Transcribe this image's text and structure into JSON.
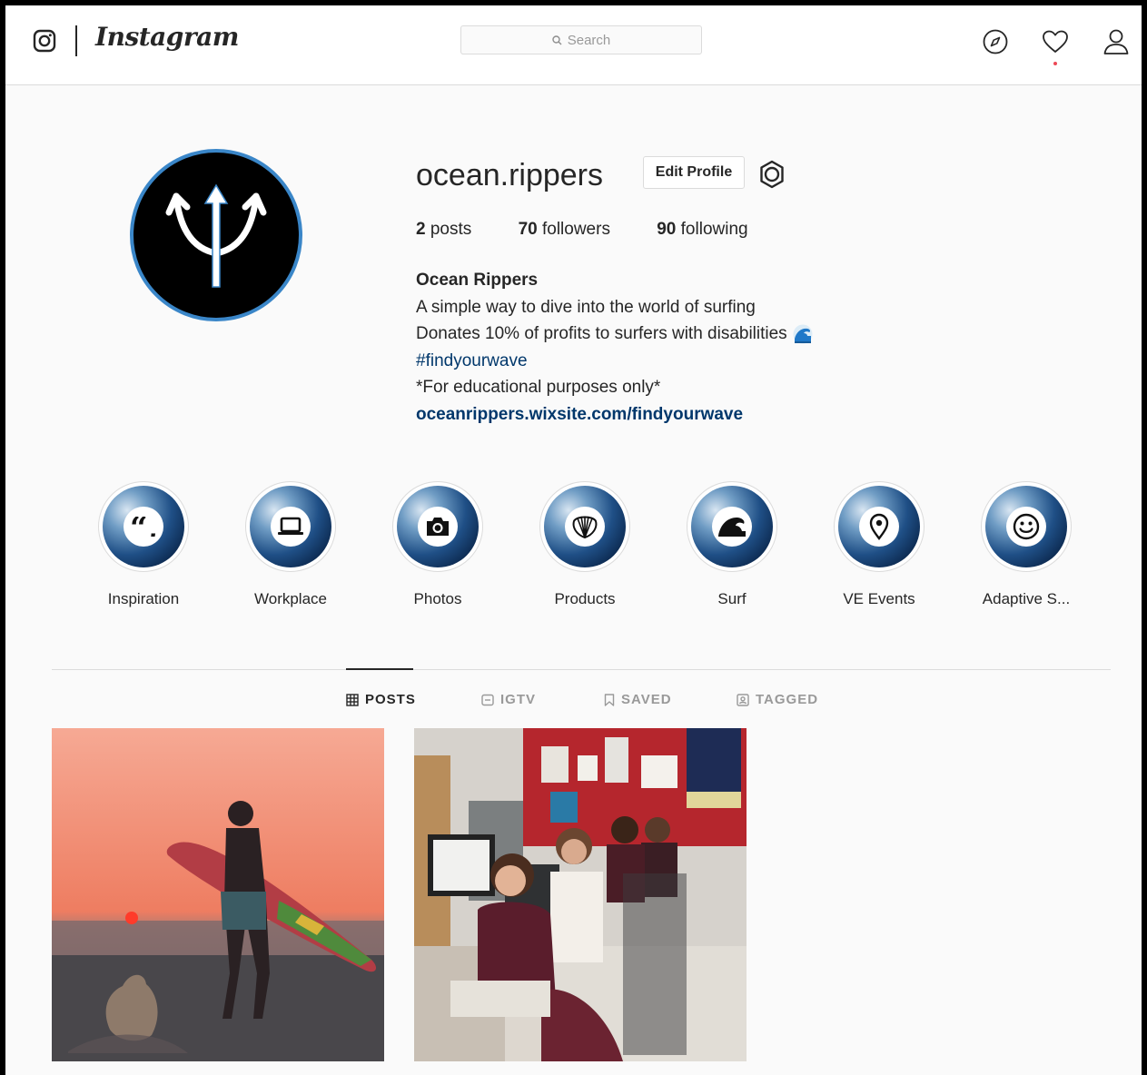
{
  "nav": {
    "logo_text": "Instagram",
    "search_placeholder": "Search",
    "icons": [
      "camera-icon",
      "compass-icon",
      "heart-icon",
      "user-icon"
    ]
  },
  "profile": {
    "username": "ocean.rippers",
    "edit_button": "Edit Profile",
    "stats": {
      "posts_count": "2",
      "posts_label": " posts",
      "followers_count": "70",
      "followers_label": " followers",
      "following_count": "90",
      "following_label": " following"
    },
    "bio": {
      "name": "Ocean Rippers",
      "line1": "A simple way to dive into the world of surfing",
      "line2": "Donates 10% of profits to surfers with disabilities",
      "hashtag": "#findyourwave",
      "line4": "*For educational purposes only*",
      "link": "oceanrippers.wixsite.com/findyourwave"
    },
    "avatar_icon": "trident-icon",
    "accent_color": "#3a86c8"
  },
  "highlights": [
    {
      "label": "Inspiration",
      "icon": "quote-icon"
    },
    {
      "label": "Workplace",
      "icon": "laptop-icon"
    },
    {
      "label": "Photos",
      "icon": "camera-icon"
    },
    {
      "label": "Products",
      "icon": "shell-icon"
    },
    {
      "label": "Surf",
      "icon": "wave-icon"
    },
    {
      "label": "VE Events",
      "icon": "location-pin-icon"
    },
    {
      "label": "Adaptive S...",
      "icon": "smiley-icon"
    }
  ],
  "tabs": [
    {
      "label": "POSTS",
      "active": true,
      "icon": "grid-icon"
    },
    {
      "label": "IGTV",
      "active": false,
      "icon": "tv-icon"
    },
    {
      "label": "SAVED",
      "active": false,
      "icon": "bookmark-icon"
    },
    {
      "label": "TAGGED",
      "active": false,
      "icon": "tag-icon"
    }
  ],
  "posts": [
    {
      "type": "image",
      "subject": "surfer-sunset"
    },
    {
      "type": "image",
      "subject": "classroom-group"
    }
  ]
}
